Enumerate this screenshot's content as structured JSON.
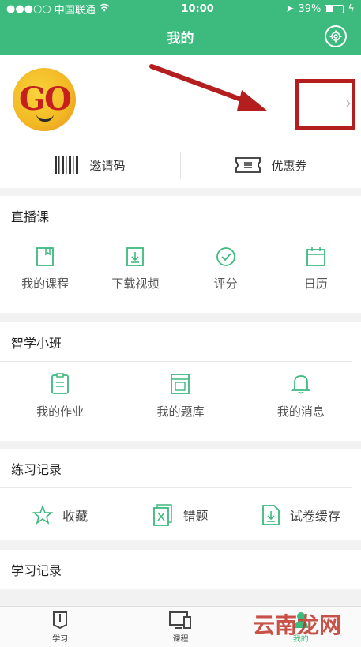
{
  "status": {
    "carrier": "中国联通",
    "time": "10:00",
    "battery": "39%"
  },
  "nav": {
    "title": "我的"
  },
  "profile": {
    "invite_label": "邀请码",
    "coupon_label": "优惠券"
  },
  "live": {
    "title": "直播课",
    "items": [
      {
        "label": "我的课程",
        "icon": "book-icon"
      },
      {
        "label": "下载视频",
        "icon": "download-icon"
      },
      {
        "label": "评分",
        "icon": "check-circle-icon"
      },
      {
        "label": "日历",
        "icon": "calendar-icon"
      }
    ]
  },
  "class": {
    "title": "智学小班",
    "items": [
      {
        "label": "我的作业",
        "icon": "clipboard-icon"
      },
      {
        "label": "我的题库",
        "icon": "question-bank-icon"
      },
      {
        "label": "我的消息",
        "icon": "bell-icon"
      }
    ]
  },
  "practice": {
    "title": "练习记录",
    "items": [
      {
        "label": "收藏",
        "icon": "star-icon"
      },
      {
        "label": "错题",
        "icon": "wrong-question-icon"
      },
      {
        "label": "试卷缓存",
        "icon": "paper-cache-icon"
      }
    ]
  },
  "study": {
    "title": "学习记录"
  },
  "tabs": [
    {
      "label": "学习",
      "icon": "study-icon"
    },
    {
      "label": "课程",
      "icon": "course-icon"
    },
    {
      "label": "我的",
      "icon": "me-icon"
    }
  ],
  "watermark": "云南龙网"
}
